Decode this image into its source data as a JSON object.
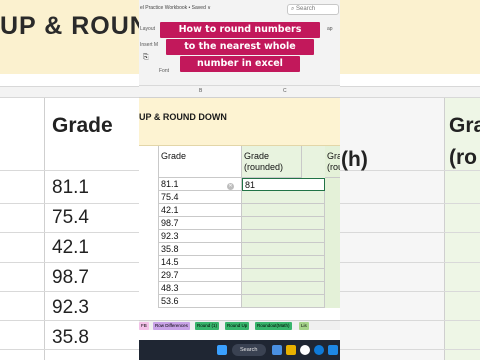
{
  "background": {
    "band_title": "UP & ROUND",
    "heading_left": "Grade",
    "heading_right_1": "Gra",
    "heading_right_2": "(ro",
    "heading_mid": "(h)",
    "values": [
      "81.1",
      "75.4",
      "42.1",
      "98.7",
      "92.3",
      "35.8"
    ]
  },
  "caption": {
    "lines": [
      "How to round numbers",
      "to the nearest whole",
      "number in excel"
    ],
    "bg_color": "#c2185b"
  },
  "ribbon": {
    "title": "el Practice Workbook • Saved ∨",
    "search_placeholder": "Search",
    "fragments": [
      "Layout",
      "Insert M",
      "Font",
      "ap"
    ]
  },
  "columns": {
    "b": "B",
    "c": "C"
  },
  "band": {
    "text": "UP & ROUND DOWN"
  },
  "table": {
    "header_grade": "Grade",
    "header_rounded": "Grade (rounded)",
    "header_partial": "Grad (rou",
    "grades": [
      "81.1",
      "75.4",
      "42.1",
      "98.7",
      "92.3",
      "35.8",
      "14.5",
      "29.7",
      "48.3",
      "53.6"
    ],
    "rounded": [
      "81",
      "",
      "",
      "",
      "",
      "",
      "",
      "",
      "",
      ""
    ]
  },
  "sheet_tabs": [
    {
      "label": "FB",
      "color": "#f3c1e8"
    },
    {
      "label": "Row Differences",
      "color": "#c9a3e8"
    },
    {
      "label": "Round (1)",
      "color": "#38b56c"
    },
    {
      "label": "Round Up",
      "color": "#38b56c"
    },
    {
      "label": "Roundout(Math)",
      "color": "#38b56c"
    },
    {
      "label": "Lis",
      "color": "#a6d48a"
    }
  ],
  "taskbar": {
    "search_label": "Search"
  }
}
